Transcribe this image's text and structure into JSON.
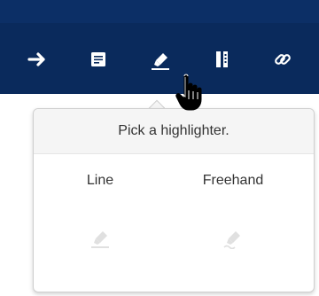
{
  "toolbar": {
    "background": "#0a2a5c",
    "tools": [
      {
        "name": "arrow-right-icon"
      },
      {
        "name": "note-icon"
      },
      {
        "name": "highlighter-icon"
      },
      {
        "name": "columns-icon"
      },
      {
        "name": "link-icon"
      }
    ]
  },
  "popover": {
    "title": "Pick a highlighter.",
    "options": [
      {
        "label": "Line",
        "icon": "line-highlighter-icon"
      },
      {
        "label": "Freehand",
        "icon": "freehand-highlighter-icon"
      }
    ]
  },
  "colors": {
    "toolbar": "#0a2a5c",
    "icon": "#ffffff",
    "muted_icon": "#e0e0e0"
  }
}
